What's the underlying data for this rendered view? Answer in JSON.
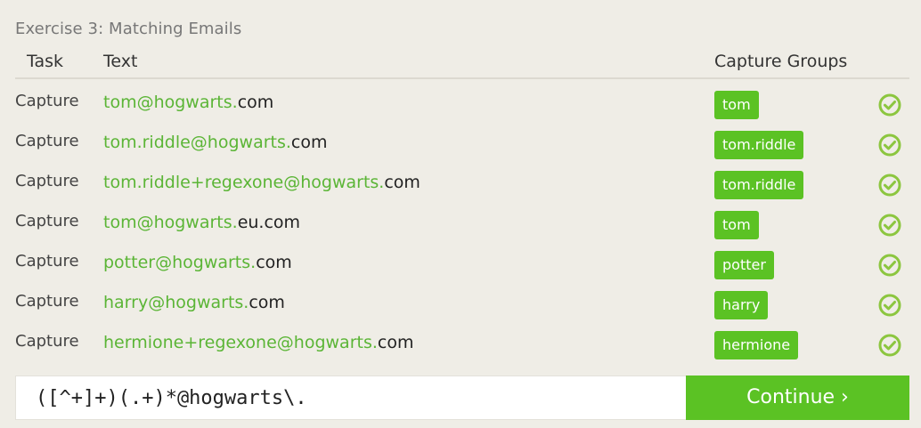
{
  "exercise_title": "Exercise 3: Matching Emails",
  "table": {
    "headers": {
      "task": "Task",
      "text": "Text",
      "capture": "Capture Groups"
    },
    "rows": [
      {
        "task": "Capture",
        "match": "tom@hogwarts.",
        "rest": "com",
        "group": "tom",
        "status": "check-circle-icon"
      },
      {
        "task": "Capture",
        "match": "tom.riddle@hogwarts.",
        "rest": "com",
        "group": "tom.riddle",
        "status": "check-circle-icon"
      },
      {
        "task": "Capture",
        "match": "tom.riddle+regexone@hogwarts.",
        "rest": "com",
        "group": "tom.riddle",
        "status": "check-circle-icon"
      },
      {
        "task": "Capture",
        "match": "tom@hogwarts.",
        "rest": "eu.com",
        "group": "tom",
        "status": "check-circle-icon"
      },
      {
        "task": "Capture",
        "match": "potter@hogwarts.",
        "rest": "com",
        "group": "potter",
        "status": "check-circle-icon"
      },
      {
        "task": "Capture",
        "match": "harry@hogwarts.",
        "rest": "com",
        "group": "harry",
        "status": "check-circle-icon"
      },
      {
        "task": "Capture",
        "match": "hermione+regexone@hogwarts.",
        "rest": "com",
        "group": "hermione",
        "status": "check-circle-icon"
      }
    ]
  },
  "regex_input": {
    "value": "([^+]+)(.+)*@hogwarts\\."
  },
  "continue_button": {
    "label": "Continue ›"
  },
  "colors": {
    "accent_green": "#5bc224",
    "match_green": "#5bb536",
    "check_green": "#8cc63f",
    "background": "#efede6"
  }
}
